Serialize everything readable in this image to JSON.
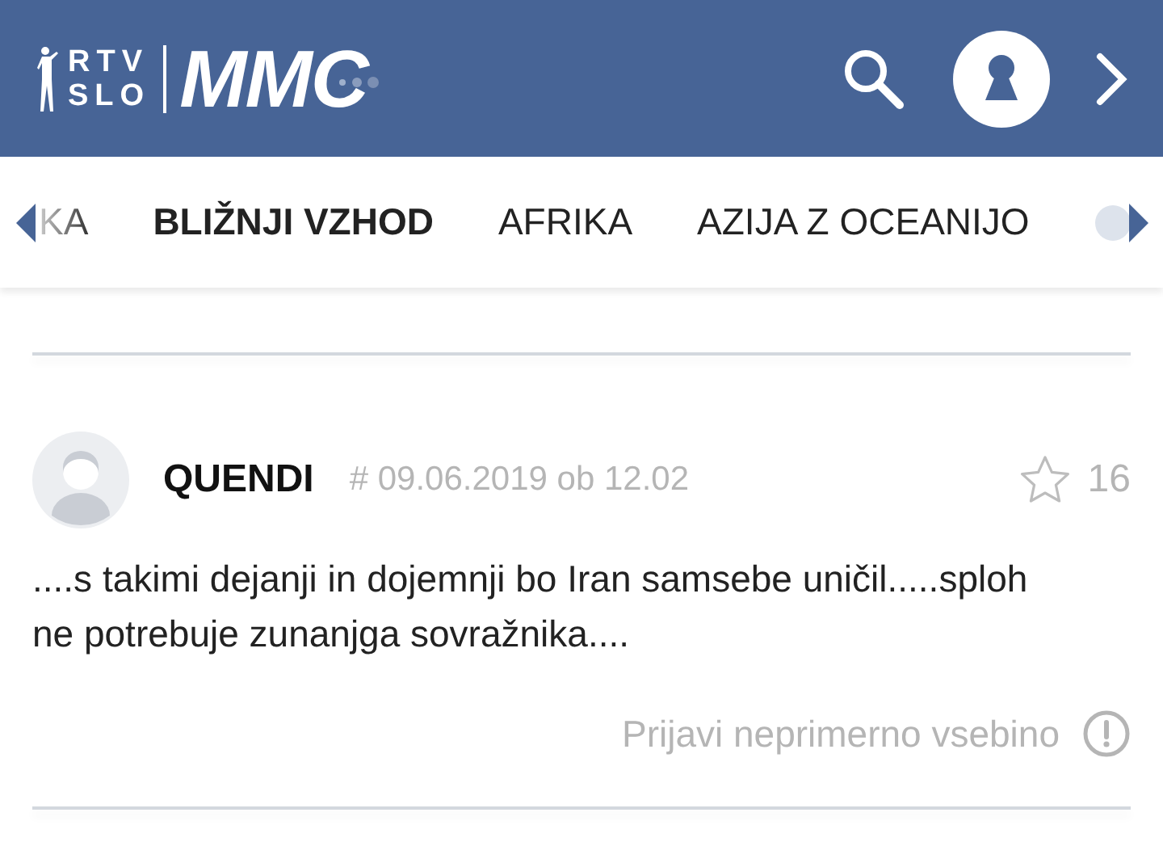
{
  "header": {
    "logo_small": [
      "RTV",
      "SLO"
    ],
    "logo_big": "MMC"
  },
  "tabs": [
    {
      "label": "KA",
      "selected": false,
      "faded": true
    },
    {
      "label": "BLIŽNJI VZHOD",
      "selected": true,
      "faded": false
    },
    {
      "label": "AFRIKA",
      "selected": false,
      "faded": false
    },
    {
      "label": "AZIJA Z OCEANIJO",
      "selected": false,
      "faded": false
    }
  ],
  "comment": {
    "author": "QUENDI",
    "timestamp": "# 09.06.2019 ob 12.02",
    "starred": false,
    "likes": "16",
    "text": "....s takimi dejanji in dojemnji bo Iran samsebe uničil.....sploh ne potrebuje zunanjga sovražnika....",
    "report": "Prijavi neprimerno vsebino"
  }
}
